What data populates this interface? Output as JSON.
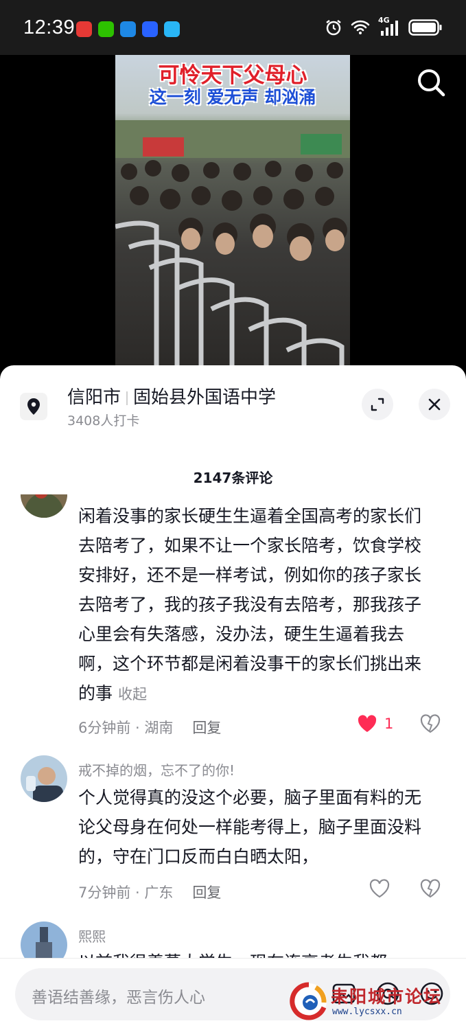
{
  "status_bar": {
    "time": "12:39",
    "network": "4G",
    "icons": [
      "huawei-app-icon",
      "wechat-icon",
      "blue-app-icon",
      "baidu-icon",
      "blue-round-app-icon",
      "alarm-icon",
      "wifi-icon",
      "signal-icon",
      "battery-icon"
    ]
  },
  "video": {
    "title_line1": "可怜天下父母心",
    "title_line2": "这一刻 爱无声 却汹涌",
    "title_color1": "#e0202a",
    "title_color2": "#1d4fd6"
  },
  "location": {
    "city": "信阳市",
    "place": "固始县外国语中学",
    "checkins": "3408人打卡"
  },
  "comments_header": {
    "count_label": "2147条评论"
  },
  "comments": [
    {
      "name": "",
      "text": "闲着没事的家长硬生生逼着全国高考的家长们去陪考了，如果不让一个家长陪考，饮食学校安排好，还不是一样考试，例如你的孩子家长去陪考了，我的孩子我没有去陪考，那我孩子心里会有失落感，没办法，硬生生逼着我去啊，这个环节都是闲着没事干的家长们挑出来的事",
      "collapse_label": "收起",
      "time": "6分钟前",
      "region": "湖南",
      "reply_label": "回复",
      "likes": "1",
      "liked": true
    },
    {
      "name": "戒不掉的烟，忘不了的你!",
      "text": "个人觉得真的没这个必要，脑子里面有料的无论父母身在何处一样能考得上，脑子里面没料的，守在门口反而白白晒太阳，",
      "time": "7分钟前",
      "region": "广东",
      "reply_label": "回复",
      "likes": "",
      "liked": false
    },
    {
      "name": "熙熙",
      "text": "以前我很羡慕大学生，现在连高考生我都",
      "time": "",
      "region": "",
      "reply_label": "",
      "likes": "",
      "liked": false
    }
  ],
  "input": {
    "placeholder": "善语结善缘，恶言伤人心"
  },
  "watermark": {
    "text": "耒阳城市论坛",
    "url": "www.lycsxx.cn"
  },
  "colors": {
    "like_red": "#fe2c55",
    "text_primary": "#161823",
    "text_secondary": "#8a8b91"
  }
}
